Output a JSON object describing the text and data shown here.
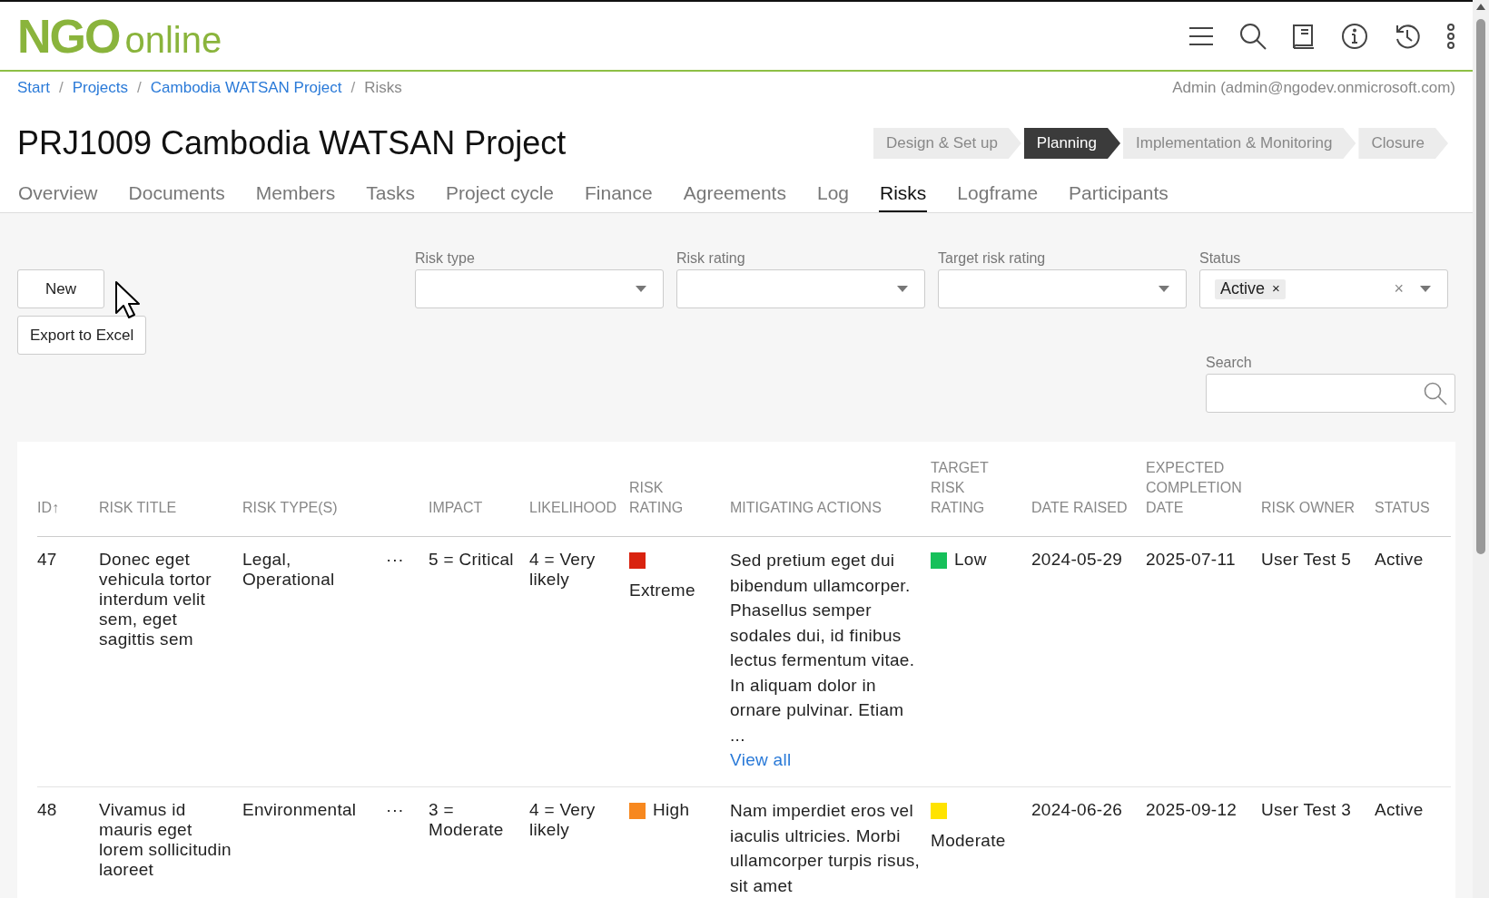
{
  "logo": {
    "primary": "NGO",
    "secondary": "online"
  },
  "breadcrumb": [
    {
      "label": "Start",
      "link": true,
      "separator": "/"
    },
    {
      "label": "Projects",
      "link": true,
      "separator": "/"
    },
    {
      "label": "Cambodia WATSAN Project",
      "link": true,
      "separator": "/"
    },
    {
      "label": "Risks",
      "link": false
    }
  ],
  "user": "Admin (admin@ngodev.onmicrosoft.com)",
  "title": "PRJ1009 Cambodia WATSAN Project",
  "phases": [
    {
      "label": "Design & Set up",
      "selected": false
    },
    {
      "label": "Planning",
      "selected": true
    },
    {
      "label": "Implementation & Monitoring",
      "selected": false
    },
    {
      "label": "Closure",
      "selected": false
    }
  ],
  "tabs": [
    {
      "label": "Overview",
      "selected": false
    },
    {
      "label": "Documents",
      "selected": false
    },
    {
      "label": "Members",
      "selected": false
    },
    {
      "label": "Tasks",
      "selected": false
    },
    {
      "label": "Project cycle",
      "selected": false
    },
    {
      "label": "Finance",
      "selected": false
    },
    {
      "label": "Agreements",
      "selected": false
    },
    {
      "label": "Log",
      "selected": false
    },
    {
      "label": "Risks",
      "selected": true
    },
    {
      "label": "Logframe",
      "selected": false
    },
    {
      "label": "Participants",
      "selected": false
    }
  ],
  "buttons": [
    "New",
    "Export to Excel"
  ],
  "filters": [
    {
      "label": "Risk type"
    },
    {
      "label": "Risk rating"
    },
    {
      "label": "Target risk rating"
    },
    {
      "label": "Status",
      "chips": [
        "Active"
      ],
      "chip_remove": "×",
      "clear": "×"
    }
  ],
  "search": {
    "label": "Search"
  },
  "table": {
    "columns": [
      "ID↑",
      "RISK TITLE",
      "RISK TYPE(S)",
      "",
      "IMPACT",
      "LIKELIHOOD",
      "RISK RATING",
      "MITIGATING ACTIONS",
      "TARGET RISK RATING",
      "DATE RAISED",
      "EXPECTED COMPLETION DATE",
      "RISK OWNER",
      "STATUS"
    ],
    "rows": [
      {
        "id": "47",
        "title": "Donec eget vehicula tortor interdum velit sem, eget sagittis sem",
        "types": "Legal, Operational",
        "more": "···",
        "impact": "5 = Critical",
        "likelihood": "4 = Very likely",
        "rating": {
          "label": "Extreme",
          "color": "#d9230f"
        },
        "mitigating": "Sed pretium eget dui bibendum ullamcorper. Phasellus semper sodales dui, id finibus lectus fermentum vitae. In aliquam dolor in ornare pulvinar. Etiam ...",
        "view_all": "View all",
        "target": {
          "label": "Low",
          "color": "#16c05a"
        },
        "date_raised": "2024-05-29",
        "expected": "2025-07-11",
        "owner": "User Test 5",
        "status": "Active"
      },
      {
        "id": "48",
        "title": "Vivamus id mauris eget lorem sollicitudin laoreet",
        "types": "Environmental",
        "more": "···",
        "impact": "3 = Moderate",
        "likelihood": "4 = Very likely",
        "rating": {
          "label": "High",
          "color": "#f7881f"
        },
        "mitigating": "Nam imperdiet eros vel iaculis ultricies. Morbi ullamcorper turpis risus, sit amet",
        "target": {
          "label": "Moderate",
          "color": "#ffe300"
        },
        "date_raised": "2024-06-26",
        "expected": "2025-09-12",
        "owner": "User Test 3",
        "status": "Active"
      }
    ]
  }
}
